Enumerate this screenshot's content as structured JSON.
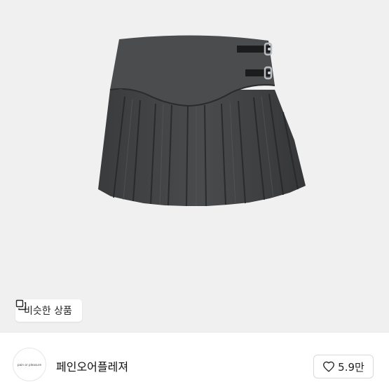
{
  "product": {
    "image_alt": "gray pleated mini skirt with double buckle straps",
    "similar_button": {
      "icon": "copy-squares-icon",
      "label": "비슷한 상품"
    }
  },
  "shop": {
    "logo_text": "pain or pleasure",
    "name": "페인오어플레져"
  },
  "like": {
    "icon": "heart-outline-icon",
    "count": "5.9만"
  }
}
